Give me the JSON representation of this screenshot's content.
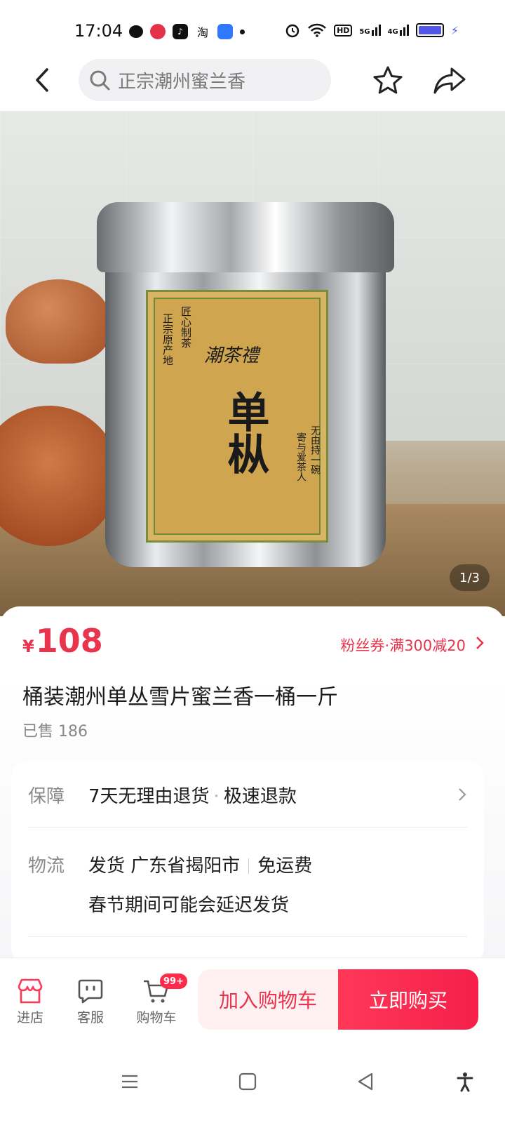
{
  "status": {
    "time": "17:04",
    "network": [
      "HD",
      "5G",
      "4G"
    ]
  },
  "header": {
    "search_text": "正宗潮州蜜兰香"
  },
  "gallery": {
    "counter": "1/3",
    "label_lines": {
      "brand": "潮茶禮",
      "main": "单枞",
      "left_col1": "正宗原产地",
      "left_col2": "匠心制茶",
      "right_col1": "无由持一碗",
      "right_col2": "寄与爱茶人"
    }
  },
  "product": {
    "currency": "¥",
    "price": "108",
    "coupon": "粉丝券·满300减20",
    "title": "桶装潮州单丛雪片蜜兰香一桶一斤",
    "sold": "已售 186"
  },
  "services": {
    "guarantee_label": "保障",
    "guarantee_a": "7天无理由退货",
    "guarantee_sep": "·",
    "guarantee_b": "极速退款",
    "logistics_label": "物流",
    "ship_from": "发货 广东省揭阳市",
    "shipping_fee": "免运费",
    "notice": "春节期间可能会延迟发货"
  },
  "action_bar": {
    "store": "进店",
    "service": "客服",
    "cart": "购物车",
    "cart_badge": "99+",
    "add_to_cart": "加入购物车",
    "buy_now": "立即购买"
  },
  "colors": {
    "accent": "#e8344d",
    "buy_gradient_start": "#ff3858",
    "buy_gradient_end": "#f51f4a"
  }
}
